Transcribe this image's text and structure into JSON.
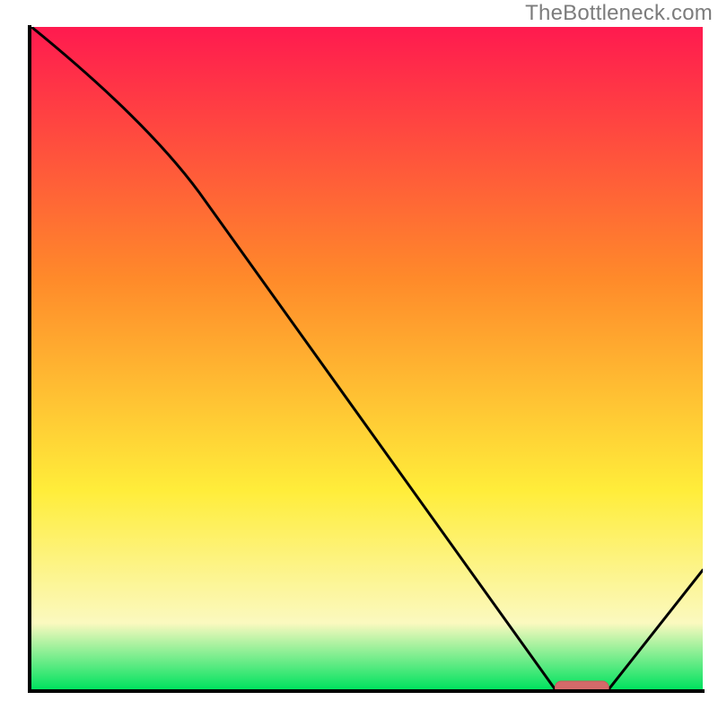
{
  "watermark": "TheBottleneck.com",
  "colors": {
    "gradient_red": "#ff1a4f",
    "gradient_orange": "#ff8a2a",
    "gradient_yellow": "#ffed3a",
    "gradient_pale": "#fbf9bf",
    "gradient_green": "#00e25f",
    "axis": "#000000",
    "curve": "#000000",
    "marker_fill": "#d46a6a",
    "marker_stroke": "#c95a5a"
  },
  "chart_data": {
    "type": "line",
    "title": "",
    "xlabel": "",
    "ylabel": "",
    "xlim": [
      0,
      100
    ],
    "ylim": [
      0,
      100
    ],
    "x": [
      0,
      25,
      78,
      86,
      100
    ],
    "values": [
      100,
      75,
      0,
      0,
      18
    ],
    "marker": {
      "x_start": 78,
      "x_end": 86,
      "y": 0
    },
    "notes": "Normalized 0-100. Curve descends from top-left; slope steepens after x≈25; reaches y=0 on x∈[78,86]; rises to y≈18 at x=100. Red rounded marker sits on the x-axis under the minimum."
  }
}
